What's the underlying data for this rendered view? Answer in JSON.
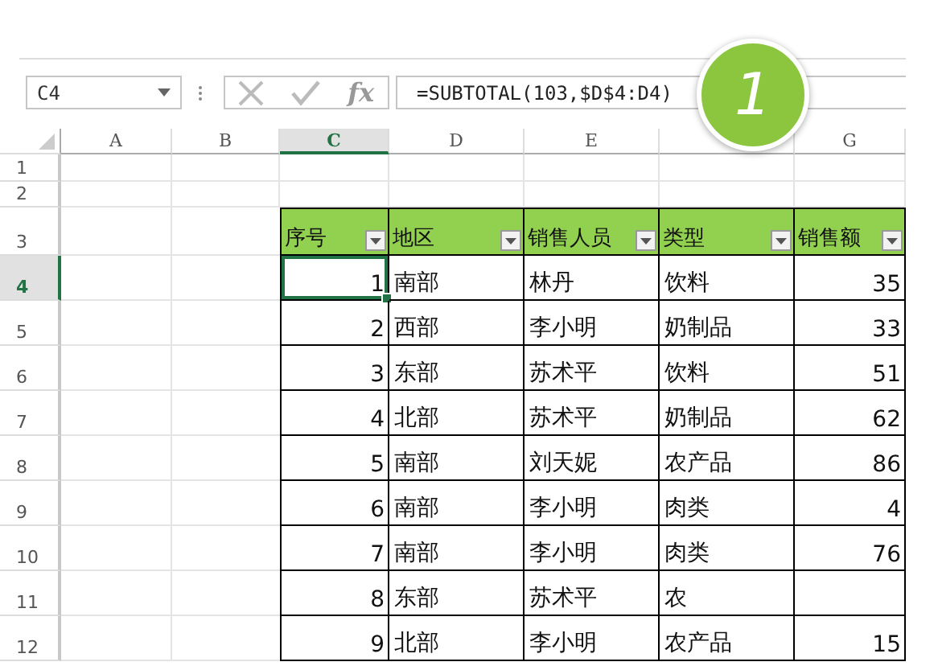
{
  "name_box": {
    "value": "C4"
  },
  "formula_bar": {
    "fx_label": "fx",
    "formula": "=SUBTOTAL(103,$D$4:D4)"
  },
  "callout": {
    "label": "1"
  },
  "sheet": {
    "column_headers": [
      {
        "label": "A",
        "selected": false
      },
      {
        "label": "B",
        "selected": false
      },
      {
        "label": "C",
        "selected": true
      },
      {
        "label": "D",
        "selected": false
      },
      {
        "label": "E",
        "selected": false
      },
      {
        "selected": false
      },
      {
        "label": "G",
        "selected": false
      }
    ],
    "row_headers": [
      {
        "label": "1",
        "selected": false
      },
      {
        "label": "2",
        "selected": false
      },
      {
        "label": "3",
        "selected": false
      },
      {
        "label": "4",
        "selected": true
      },
      {
        "label": "5",
        "selected": false
      },
      {
        "label": "6",
        "selected": false
      },
      {
        "label": "7",
        "selected": false
      },
      {
        "label": "8",
        "selected": false
      },
      {
        "label": "9",
        "selected": false
      },
      {
        "label": "10",
        "selected": false
      },
      {
        "label": "11",
        "selected": false
      },
      {
        "label": "12",
        "selected": false
      }
    ]
  },
  "table": {
    "columns": [
      {
        "label": "序号"
      },
      {
        "label": "地区"
      },
      {
        "label": "销售人员"
      },
      {
        "label": "类型"
      },
      {
        "label": "销售额"
      }
    ],
    "rows": [
      {
        "cells": [
          "1",
          "南部",
          "林丹",
          "饮料",
          "35"
        ]
      },
      {
        "cells": [
          "2",
          "西部",
          "李小明",
          "奶制品",
          "33"
        ]
      },
      {
        "cells": [
          "3",
          "东部",
          "苏术平",
          "饮料",
          "51"
        ]
      },
      {
        "cells": [
          "4",
          "北部",
          "苏术平",
          "奶制品",
          "62"
        ]
      },
      {
        "cells": [
          "5",
          "南部",
          "刘天妮",
          "农产品",
          "86"
        ]
      },
      {
        "cells": [
          "6",
          "南部",
          "李小明",
          "肉类",
          "4"
        ]
      },
      {
        "cells": [
          "7",
          "南部",
          "李小明",
          "肉类",
          "76"
        ]
      },
      {
        "cells": [
          "8",
          "东部",
          "苏术平",
          "农"
        ]
      },
      {
        "cells": [
          "9",
          "北部",
          "李小明",
          "农产品",
          "15"
        ]
      }
    ]
  }
}
